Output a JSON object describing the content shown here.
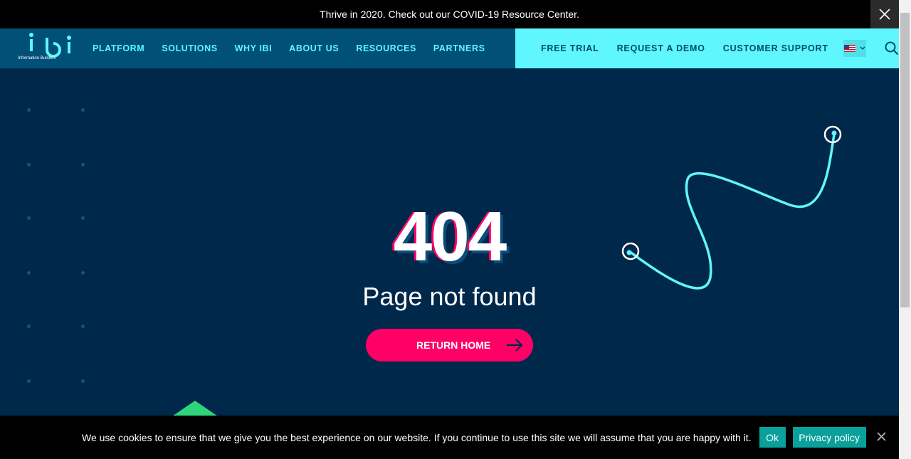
{
  "announcement": {
    "text": "Thrive in 2020. Check out our COVID-19 Resource Center.",
    "close_icon": "close-icon"
  },
  "brand": {
    "logo_word": "ibi",
    "logo_sub": "Information Builders"
  },
  "nav": {
    "items": [
      "PLATFORM",
      "SOLUTIONS",
      "WHY IBI",
      "ABOUT US",
      "RESOURCES",
      "PARTNERS"
    ]
  },
  "utility": {
    "items": [
      "FREE TRIAL",
      "REQUEST A DEMO",
      "CUSTOMER SUPPORT"
    ],
    "language_icon": "us-flag-icon",
    "search_icon": "search-icon"
  },
  "hero": {
    "code": "404",
    "message": "Page not found",
    "button_label": "RETURN HOME",
    "button_icon": "arrow-right-icon"
  },
  "cookie": {
    "text": "We use cookies to ensure that we give you the best experience on our website. If you continue to use this site we will assume that you are happy with it.",
    "ok_label": "Ok",
    "privacy_label": "Privacy policy"
  },
  "colors": {
    "background": "#00284a",
    "header": "#005078",
    "accent_cyan": "#5ff6ff",
    "accent_pink": "#ff0066",
    "cookie_button": "#0aa09b",
    "triangle": "#2ed37a"
  }
}
